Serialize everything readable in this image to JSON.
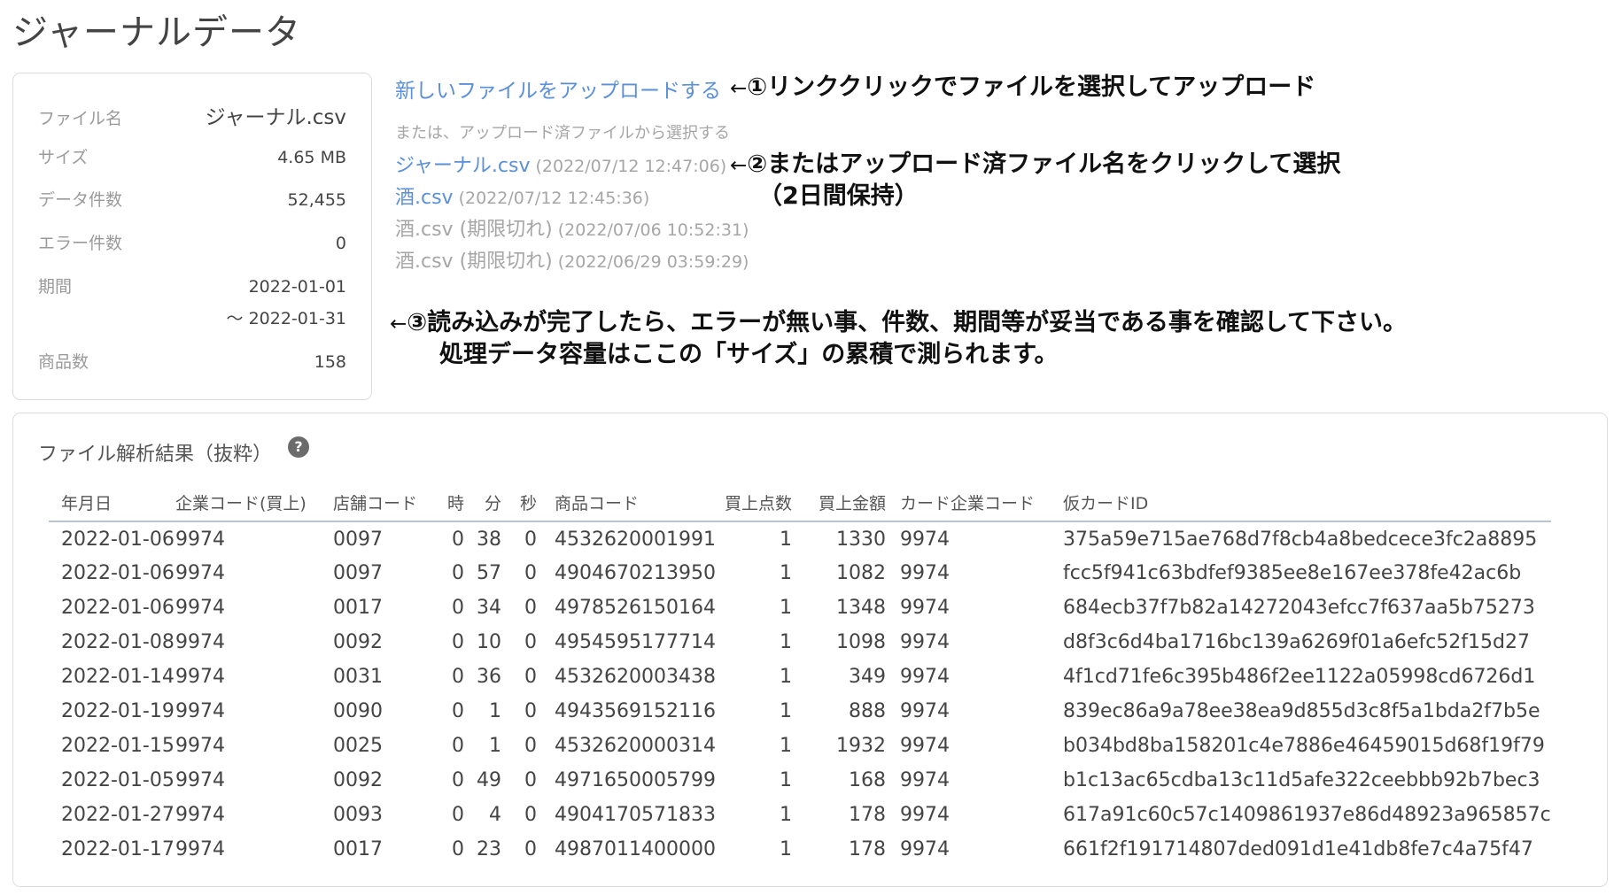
{
  "page": {
    "title": "ジャーナルデータ"
  },
  "file_info": {
    "file_name_label": "ファイル名",
    "file_name": "ジャーナル.csv",
    "size_label": "サイズ",
    "size": "4.65 MB",
    "record_count_label": "データ件数",
    "record_count": "52,455",
    "error_count_label": "エラー件数",
    "error_count": "0",
    "period_label": "期間",
    "period_start": "2022-01-01",
    "period_end": "〜 2022-01-31",
    "product_count_label": "商品数",
    "product_count": "158"
  },
  "upload": {
    "new_upload_link": "新しいファイルをアップロードする",
    "or_select_text": "または、アップロード済ファイルから選択する",
    "files": [
      {
        "name": "ジャーナル.csv",
        "date": "(2022/07/12 12:47:06)",
        "expired": false
      },
      {
        "name": "酒.csv",
        "date": "(2022/07/12 12:45:36)",
        "expired": false
      },
      {
        "name": "酒.csv (期限切れ)",
        "date": "(2022/07/06 10:52:31)",
        "expired": true
      },
      {
        "name": "酒.csv (期限切れ)",
        "date": "(2022/06/29 03:59:29)",
        "expired": true
      }
    ]
  },
  "annotations": {
    "arrow": "←",
    "ann1": "①リンククリックでファイルを選択してアップロード",
    "ann2_line1": "②またはアップロード済ファイル名をクリックして選択",
    "ann2_line2": "（2日間保持）",
    "ann3_line1": "③読み込みが完了したら、エラーが無い事、件数、期間等が妥当である事を確認して下さい。",
    "ann3_line2": "処理データ容量はここの「サイズ」の累積で測られます。"
  },
  "analysis": {
    "title": "ファイル解析結果（抜粋）",
    "help_icon": "question-icon",
    "help_glyph": "?",
    "columns": [
      "年月日",
      "企業コード(買上)",
      "店舗コード",
      "時",
      "分",
      "秒",
      "商品コード",
      "買上点数",
      "買上金額",
      "カード企業コード",
      "仮カードID"
    ],
    "rows": [
      [
        "2022-01-06",
        "9974",
        "0097",
        "0",
        "38",
        "0",
        "4532620001991",
        "1",
        "1330",
        "9974",
        "375a59e715ae768d7f8cb4a8bedcece3fc2a8895"
      ],
      [
        "2022-01-06",
        "9974",
        "0097",
        "0",
        "57",
        "0",
        "4904670213950",
        "1",
        "1082",
        "9974",
        "fcc5f941c63bdfef9385ee8e167ee378fe42ac6b"
      ],
      [
        "2022-01-06",
        "9974",
        "0017",
        "0",
        "34",
        "0",
        "4978526150164",
        "1",
        "1348",
        "9974",
        "684ecb37f7b82a14272043efcc7f637aa5b75273"
      ],
      [
        "2022-01-08",
        "9974",
        "0092",
        "0",
        "10",
        "0",
        "4954595177714",
        "1",
        "1098",
        "9974",
        "d8f3c6d4ba1716bc139a6269f01a6efc52f15d27"
      ],
      [
        "2022-01-14",
        "9974",
        "0031",
        "0",
        "36",
        "0",
        "4532620003438",
        "1",
        "349",
        "9974",
        "4f1cd71fe6c395b486f2ee1122a05998cd6726d1"
      ],
      [
        "2022-01-19",
        "9974",
        "0090",
        "0",
        "1",
        "0",
        "4943569152116",
        "1",
        "888",
        "9974",
        "839ec86a9a78ee38ea9d855d3c8f5a1bda2f7b5e"
      ],
      [
        "2022-01-15",
        "9974",
        "0025",
        "0",
        "1",
        "0",
        "4532620000314",
        "1",
        "1932",
        "9974",
        "b034bd8ba158201c4e7886e46459015d68f19f79"
      ],
      [
        "2022-01-05",
        "9974",
        "0092",
        "0",
        "49",
        "0",
        "4971650005799",
        "1",
        "168",
        "9974",
        "b1c13ac65cdba13c11d5afe322ceebbb92b7bec3"
      ],
      [
        "2022-01-27",
        "9974",
        "0093",
        "0",
        "4",
        "0",
        "4904170571833",
        "1",
        "178",
        "9974",
        "617a91c60c57c1409861937e86d48923a965857c"
      ],
      [
        "2022-01-17",
        "9974",
        "0017",
        "0",
        "23",
        "0",
        "4987011400000",
        "1",
        "178",
        "9974",
        "661f2f191714807ded091d1e41db8fe7c4a75f47"
      ]
    ]
  }
}
